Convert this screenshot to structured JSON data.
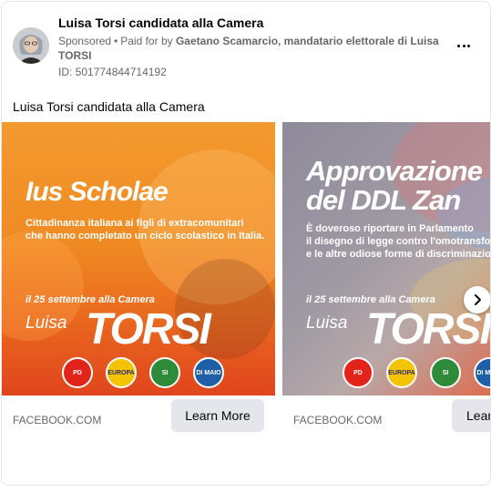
{
  "header": {
    "page_name": "Luisa Torsi candidata alla Camera",
    "sponsored": "Sponsored",
    "separator": "•",
    "paid_for_prefix": "Paid for by",
    "paid_for_by": "Gaetano Scamarcio, mandatario elettorale di Luisa TORSI",
    "ad_id": "ID: 501774844714192",
    "more_icon": "more-horizontal-icon"
  },
  "post": {
    "body_text": "Luisa Torsi candidata alla Camera"
  },
  "carousel": {
    "next_icon": "chevron-right-icon",
    "slides": [
      {
        "headline": "Ius Scholae",
        "subtext_lines": [
          "Cittadinanza italiana ai figli di extracomunitari",
          "che hanno completato un ciclo scolastico in Italia."
        ],
        "date_line": "il 25 settembre alla Camera",
        "first_name": "Luisa",
        "last_name": "TORSI",
        "domain": "FACEBOOK.COM",
        "cta": "Learn More",
        "colors": {
          "primary": "#ef8a22",
          "secondary": "#e0451d"
        }
      },
      {
        "headline_lines": [
          "Approvazione",
          "del DDL Zan"
        ],
        "subtext_lines": [
          "È doveroso riportare in Parlamento",
          "il disegno di legge contro l'omotransfob",
          "e le altre odiose forme di discriminazion"
        ],
        "date_line": "il 25 settembre alla Camera",
        "first_name": "Luisa",
        "last_name": "TORSI",
        "domain": "FACEBOOK.COM",
        "cta": "Lear",
        "colors": {
          "primary": "#9a95a2",
          "secondary": "#e0521f"
        }
      }
    ],
    "party_logos": [
      {
        "name": "PD",
        "color": "#e2231a"
      },
      {
        "name": "EUROPA",
        "color": "#2b2b7a"
      },
      {
        "name": "SI",
        "color": "#2e8b3a"
      },
      {
        "name": "DI MAIO",
        "color": "#1f5fa8"
      }
    ]
  }
}
